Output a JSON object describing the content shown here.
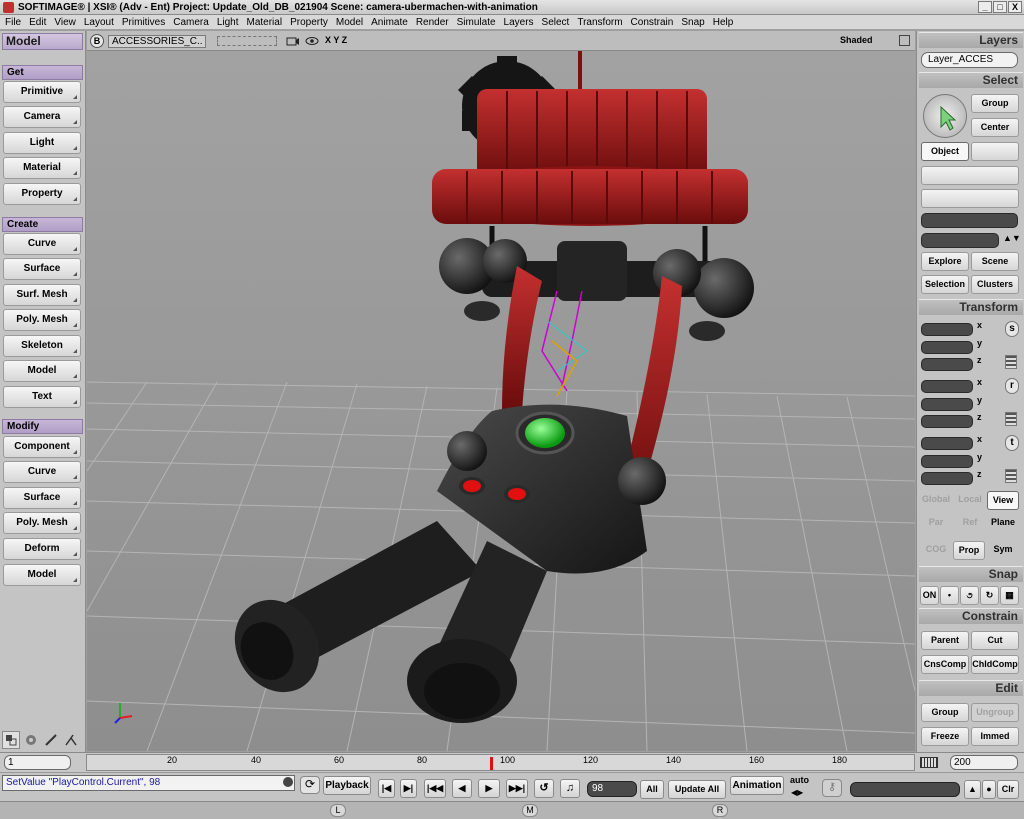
{
  "title": "SOFTIMAGE® | XSI® (Adv - Ent) Project: Update_Old_DB_021904    Scene: camera-ubermachen-with-animation",
  "window_buttons": [
    "_",
    "□",
    "X"
  ],
  "menu": [
    "File",
    "Edit",
    "View",
    "Layout",
    "Primitives",
    "Camera",
    "Light",
    "Material",
    "Property",
    "Model",
    "Animate",
    "Render",
    "Simulate",
    "Layers",
    "Select",
    "Transform",
    "Constrain",
    "Snap",
    "Help"
  ],
  "left": {
    "module": "Model",
    "get_header": "Get",
    "get_items": [
      "Primitive",
      "Camera",
      "Light",
      "Material",
      "Property"
    ],
    "create_header": "Create",
    "create_items": [
      "Curve",
      "Surface",
      "Surf. Mesh",
      "Poly. Mesh",
      "Skeleton",
      "Model",
      "Text"
    ],
    "modify_header": "Modify",
    "modify_items": [
      "Component",
      "Curve",
      "Surface",
      "Poly. Mesh",
      "Deform",
      "Model"
    ]
  },
  "viewport": {
    "badge": "B",
    "camera_name": "ACCESSORIES_C..",
    "axes_label": "X Y Z",
    "display_mode": "Shaded"
  },
  "right": {
    "layers_header": "Layers",
    "layer_value": "Layer_ACCES",
    "select_header": "Select",
    "group": "Group",
    "center": "Center",
    "object": "Object",
    "explore": "Explore",
    "scene": "Scene",
    "selection": "Selection",
    "clusters": "Clusters",
    "transform_header": "Transform",
    "axis_x": "x",
    "axis_y": "y",
    "axis_z": "z",
    "scale": "s",
    "rotate": "r",
    "translate": "t",
    "global": "Global",
    "local": "Local",
    "view": "View",
    "par": "Par",
    "ref": "Ref",
    "plane": "Plane",
    "cog": "COG",
    "prop": "Prop",
    "sym": "Sym",
    "snap_header": "Snap",
    "on": "ON",
    "constrain_header": "Constrain",
    "parent": "Parent",
    "cut": "Cut",
    "cnscomp": "CnsComp",
    "chldcomp": "ChldComp",
    "edit_header": "Edit",
    "group_btn": "Group",
    "ungroup": "Ungroup",
    "freeze": "Freeze",
    "immed": "Immed"
  },
  "timeline": {
    "start": "1",
    "end": "200",
    "ticks": [
      "20",
      "40",
      "60",
      "80",
      "100",
      "120",
      "140",
      "160",
      "180"
    ],
    "current_frame": 98,
    "range_start": 1,
    "range_end": 200
  },
  "bottom": {
    "command": "SetValue \"PlayControl.Current\", 98",
    "playback": "Playback",
    "frame": "98",
    "all": "All",
    "update_all": "Update All",
    "animation": "Animation",
    "auto": "auto",
    "clr": "Clr"
  },
  "status": {
    "l": "L",
    "m": "M",
    "r": "R"
  }
}
